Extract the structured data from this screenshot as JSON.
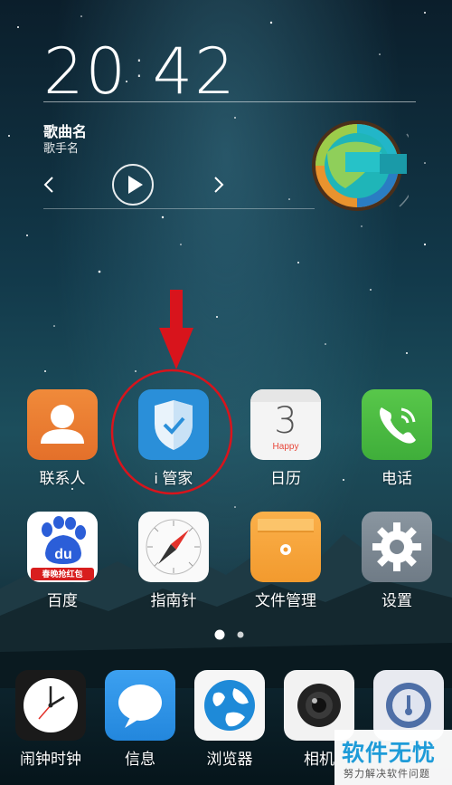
{
  "clock": {
    "hours": "20",
    "minutes": "42"
  },
  "music": {
    "song": "歌曲名",
    "artist": "歌手名"
  },
  "apps_row1": [
    {
      "label": "联系人",
      "icon": "contacts-icon"
    },
    {
      "label": "i 管家",
      "icon": "i-manager-shield-icon"
    },
    {
      "label": "日历",
      "icon": "calendar-icon",
      "day": "3",
      "tag": "Happy"
    },
    {
      "label": "电话",
      "icon": "phone-icon"
    }
  ],
  "apps_row2": [
    {
      "label": "百度",
      "icon": "baidu-icon",
      "tag": "春晚抢红包"
    },
    {
      "label": "指南针",
      "icon": "compass-icon"
    },
    {
      "label": "文件管理",
      "icon": "file-manager-icon"
    },
    {
      "label": "设置",
      "icon": "settings-icon"
    }
  ],
  "dock": [
    {
      "label": "闹钟时钟",
      "icon": "clock-icon"
    },
    {
      "label": "信息",
      "icon": "messages-icon"
    },
    {
      "label": "浏览器",
      "icon": "browser-icon"
    },
    {
      "label": "相机",
      "icon": "camera-icon"
    },
    {
      "label": "",
      "icon": "lock-app-icon"
    }
  ],
  "page_indicator": {
    "pages": 2,
    "current": 1
  },
  "watermark": {
    "title": "软件无忧",
    "subtitle": "努力解决软件问题"
  },
  "colors": {
    "highlight_annotation": "#d8141c",
    "imanager_blue": "#2a8fd9"
  }
}
